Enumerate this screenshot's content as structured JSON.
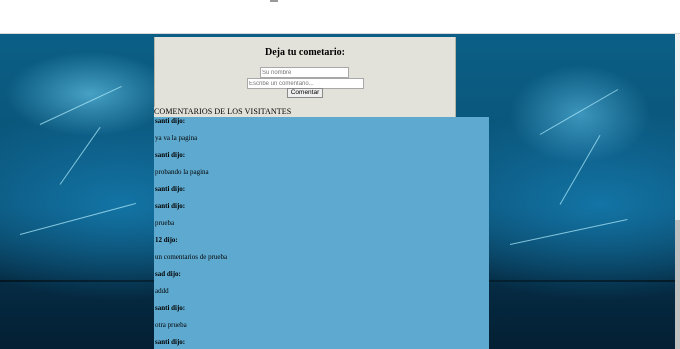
{
  "form": {
    "title": "Deja tu cometario:",
    "name_placeholder": "Su nombre",
    "comment_placeholder": "Escribe un comentario...",
    "submit_label": "Comentar"
  },
  "comments_section": {
    "heading": "COMENTARIOS DE LOS VISITANTES",
    "entries": [
      {
        "author": "santi dijo:",
        "text": "ya va la pagina"
      },
      {
        "author": "santi dijo:",
        "text": "probando la pagina"
      },
      {
        "author": "santi dijo:",
        "text": ""
      },
      {
        "author": "santi dijo:",
        "text": "prueba"
      },
      {
        "author": "12 dijo:",
        "text": "un comentarios de prueba"
      },
      {
        "author": "sad dijo:",
        "text": "addd"
      },
      {
        "author": "santi dijo:",
        "text": "otra prueba"
      },
      {
        "author": "santi dijo:",
        "text": ""
      }
    ]
  }
}
